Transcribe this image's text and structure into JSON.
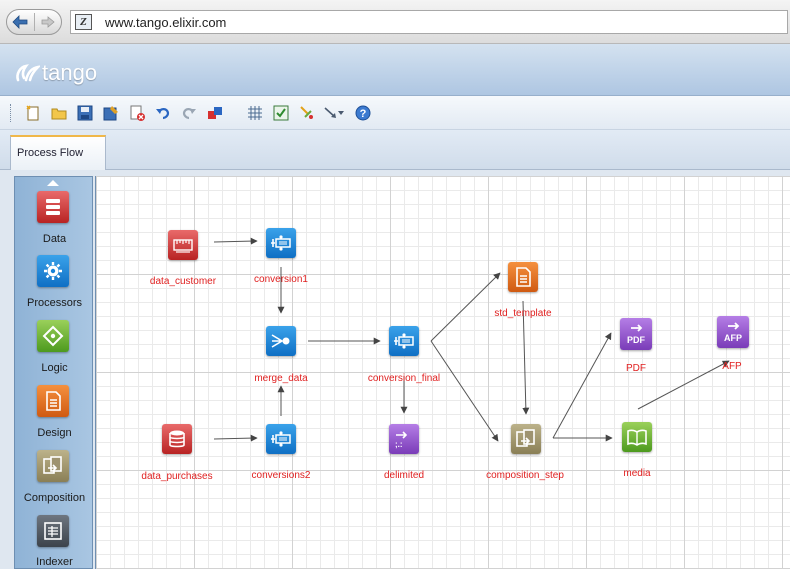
{
  "browser": {
    "url": "www.tango.elixir.com",
    "site_icon_glyph": "Z"
  },
  "app": {
    "logo_text": "tango"
  },
  "toolbar": {
    "icons": [
      "new-icon",
      "open-folder-icon",
      "save-icon",
      "save-as-icon",
      "delete-icon",
      "undo-icon",
      "redo-icon",
      "export-icon",
      "grid-icon",
      "validate-icon",
      "connect-icon",
      "pointer-icon",
      "dropdown-icon",
      "help-icon"
    ]
  },
  "tabs": [
    {
      "label": "Process Flow",
      "active": true
    }
  ],
  "palette": {
    "items": [
      {
        "label": "Data",
        "icon": "database-icon",
        "color": "#c62f2f"
      },
      {
        "label": "Processors",
        "icon": "gear-icon",
        "color": "#1682d8"
      },
      {
        "label": "Logic",
        "icon": "diamond-icon",
        "color": "#66b030"
      },
      {
        "label": "Design",
        "icon": "document-icon",
        "color": "#e2721f"
      },
      {
        "label": "Composition",
        "icon": "compose-icon",
        "color": "#9e9370"
      },
      {
        "label": "Indexer",
        "icon": "indexer-icon",
        "color": "#50575f"
      }
    ]
  },
  "flow": {
    "nodes": [
      {
        "id": "data_customer",
        "label": "data_customer",
        "icon": "ruler-icon",
        "color": "red"
      },
      {
        "id": "conversion1",
        "label": "conversion1",
        "icon": "converter-icon",
        "color": "blue"
      },
      {
        "id": "merge_data",
        "label": "merge_data",
        "icon": "merge-icon",
        "color": "blue"
      },
      {
        "id": "conversion_final",
        "label": "conversion_final",
        "icon": "converter-icon",
        "color": "blue"
      },
      {
        "id": "data_purchases",
        "label": "data_purchases",
        "icon": "database-icon",
        "color": "red"
      },
      {
        "id": "conversions2",
        "label": "conversions2",
        "icon": "converter-icon",
        "color": "blue"
      },
      {
        "id": "delimited",
        "label": "delimited",
        "icon": "delimited-output-icon",
        "color": "purple"
      },
      {
        "id": "std_template",
        "label": "std_template",
        "icon": "document-icon",
        "color": "orange"
      },
      {
        "id": "composition_step",
        "label": "composition_step",
        "icon": "compose-icon",
        "color": "olive"
      },
      {
        "id": "pdf",
        "label": "PDF",
        "icon": "pdf-output-icon",
        "color": "purple",
        "badge": "PDF"
      },
      {
        "id": "afp",
        "label": "AFP",
        "icon": "afp-output-icon",
        "color": "purple",
        "badge": "AFP"
      },
      {
        "id": "media",
        "label": "media",
        "icon": "book-icon",
        "color": "green"
      }
    ],
    "edges": [
      [
        "data_customer",
        "conversion1"
      ],
      [
        "conversion1",
        "merge_data"
      ],
      [
        "conversions2",
        "merge_data"
      ],
      [
        "data_purchases",
        "conversions2"
      ],
      [
        "merge_data",
        "conversion_final"
      ],
      [
        "conversion_final",
        "delimited"
      ],
      [
        "conversion_final",
        "std_template"
      ],
      [
        "conversion_final",
        "composition_step"
      ],
      [
        "std_template",
        "composition_step"
      ],
      [
        "composition_step",
        "pdf"
      ],
      [
        "composition_step",
        "media"
      ],
      [
        "media",
        "afp"
      ]
    ]
  }
}
